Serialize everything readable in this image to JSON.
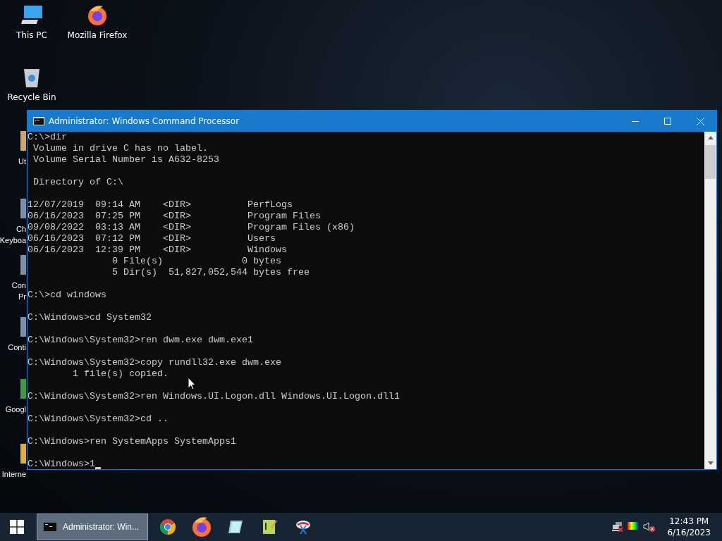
{
  "desktop_icons": [
    {
      "label": "This PC",
      "kind": "pc"
    },
    {
      "label": "Mozilla Firefox",
      "kind": "firefox"
    },
    {
      "label": "Recycle Bin",
      "kind": "bin"
    }
  ],
  "hidden_icons": [
    {
      "label": "Ut"
    },
    {
      "label": "Ch",
      "label_2": "Keyboa"
    },
    {
      "label": "Con",
      "label_2": "Pr"
    },
    {
      "label": "Conti"
    },
    {
      "label": "Googl"
    },
    {
      "label": "Interne"
    }
  ],
  "window": {
    "title": "Administrator: Windows Command Processor",
    "blocks": [
      [
        "C:\\>dir",
        " Volume in drive C has no label.",
        " Volume Serial Number is A632-8253"
      ],
      [
        " Directory of C:\\"
      ],
      [
        "12/07/2019  09:14 AM    <DIR>          PerfLogs",
        "06/16/2023  07:25 PM    <DIR>          Program Files",
        "09/08/2022  03:13 AM    <DIR>          Program Files (x86)",
        "06/16/2023  07:12 PM    <DIR>          Users",
        "06/16/2023  12:39 PM    <DIR>          Windows",
        "               0 File(s)              0 bytes",
        "               5 Dir(s)  51,827,052,544 bytes free"
      ],
      [
        "C:\\>cd windows"
      ],
      [
        "C:\\Windows>cd System32"
      ],
      [
        "C:\\Windows\\System32>ren dwm.exe dwm.exe1"
      ],
      [
        "C:\\Windows\\System32>copy rundll32.exe dwm.exe",
        "        1 file(s) copied."
      ],
      [
        "C:\\Windows\\System32>ren Windows.UI.Logon.dll Windows.UI.Logon.dll1"
      ],
      [
        "C:\\Windows\\System32>cd .."
      ],
      [
        "C:\\Windows>ren SystemApps SystemApps1"
      ],
      [
        "C:\\Windows>1"
      ]
    ]
  },
  "taskbar": {
    "task_button": {
      "label": "Administrator: Win...",
      "selected": true
    },
    "pinned": [
      {
        "kind": "chrome"
      },
      {
        "kind": "firefox"
      },
      {
        "kind": "notepad"
      },
      {
        "kind": "editor"
      },
      {
        "kind": "snip"
      }
    ],
    "time": "12:43 PM",
    "date": "6/16/2023"
  }
}
